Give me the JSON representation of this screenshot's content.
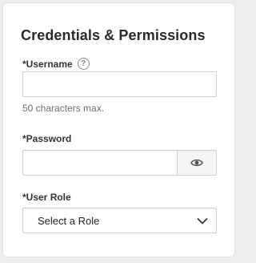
{
  "form": {
    "title": "Credentials & Permissions",
    "username": {
      "label": "*Username",
      "value": "",
      "placeholder": "",
      "hint": "50 characters max.",
      "help_icon": "question-circle-icon"
    },
    "password": {
      "label": "*Password",
      "value": "",
      "placeholder": "",
      "toggle_icon": "eye-icon"
    },
    "role": {
      "label": "*User Role",
      "selected": "Select a Role",
      "dropdown_icon": "chevron-down-icon"
    }
  },
  "colors": {
    "background": "#eeeeee",
    "card": "#ffffff",
    "border": "#cfcfcf",
    "hint_text": "#6f6f6f"
  }
}
